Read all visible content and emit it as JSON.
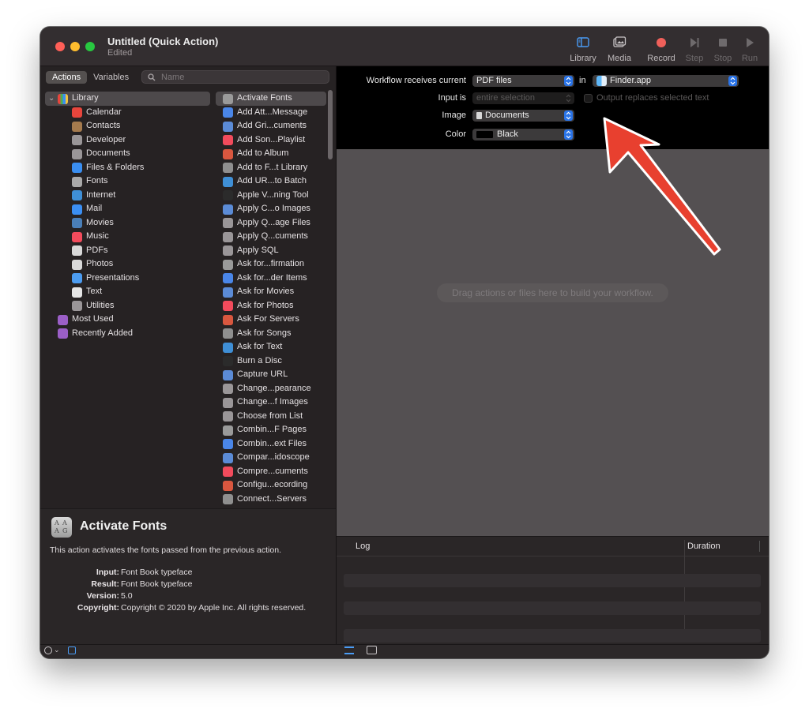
{
  "window": {
    "title": "Untitled (Quick Action)",
    "subtitle": "Edited"
  },
  "toolbar": [
    {
      "label": "Library",
      "icon": "library-icon",
      "enabled": true
    },
    {
      "label": "Media",
      "icon": "media-icon",
      "enabled": true
    },
    {
      "label": "Record",
      "icon": "record-icon",
      "enabled": true
    },
    {
      "label": "Step",
      "icon": "step-icon",
      "enabled": false
    },
    {
      "label": "Stop",
      "icon": "stop-icon",
      "enabled": false
    },
    {
      "label": "Run",
      "icon": "run-icon",
      "enabled": false
    }
  ],
  "tabs": {
    "actions": "Actions",
    "variables": "Variables"
  },
  "search": {
    "placeholder": "Name"
  },
  "library": {
    "root": "Library",
    "categories": [
      {
        "name": "Calendar",
        "color": "#e8453c"
      },
      {
        "name": "Contacts",
        "color": "#a57b4e"
      },
      {
        "name": "Developer",
        "color": "#9a9698"
      },
      {
        "name": "Documents",
        "color": "#9a9698"
      },
      {
        "name": "Files & Folders",
        "color": "#3a8ef0"
      },
      {
        "name": "Fonts",
        "color": "#a9a9a9"
      },
      {
        "name": "Internet",
        "color": "#3f8fd6"
      },
      {
        "name": "Mail",
        "color": "#3b8ff3"
      },
      {
        "name": "Movies",
        "color": "#4a7fb8"
      },
      {
        "name": "Music",
        "color": "#f24b5c"
      },
      {
        "name": "PDFs",
        "color": "#d9d9d9"
      },
      {
        "name": "Photos",
        "color": "#d9d9d9"
      },
      {
        "name": "Presentations",
        "color": "#4c9cf0"
      },
      {
        "name": "Text",
        "color": "#e5e5e5"
      },
      {
        "name": "Utilities",
        "color": "#9a9698"
      }
    ],
    "smart_groups": [
      "Most Used",
      "Recently Added"
    ]
  },
  "actions": [
    "Activate Fonts",
    "Add Att...Message",
    "Add Gri...cuments",
    "Add Son...Playlist",
    "Add to Album",
    "Add to F...t Library",
    "Add UR...to Batch",
    "Apple V...ning Tool",
    "Apply C...o Images",
    "Apply Q...age Files",
    "Apply Q...cuments",
    "Apply SQL",
    "Ask for...firmation",
    "Ask for...der Items",
    "Ask for Movies",
    "Ask for Photos",
    "Ask For Servers",
    "Ask for Songs",
    "Ask for Text",
    "Burn a Disc",
    "Capture URL",
    "Change...pearance",
    "Change...f Images",
    "Choose from List",
    "Combin...F Pages",
    "Combin...ext Files",
    "Compar...idoscope",
    "Compre...cuments",
    "Configu...ecording",
    "Connect...Servers"
  ],
  "description": {
    "title": "Activate Fonts",
    "text": "This action activates the fonts passed from the previous action.",
    "input_label": "Input:",
    "input": "Font Book typeface",
    "result_label": "Result:",
    "result": "Font Book typeface",
    "version_label": "Version:",
    "version": "5.0",
    "copyright_label": "Copyright:",
    "copyright": "Copyright © 2020 by Apple Inc. All rights reserved."
  },
  "workflow": {
    "receives_label": "Workflow receives current",
    "receives_value": "PDF files",
    "in_label": "in",
    "in_value": "Finder.app",
    "input_is_label": "Input is",
    "input_is_value": "entire selection",
    "output_replaces": "Output replaces selected text",
    "image_label": "Image",
    "image_value": "Documents",
    "color_label": "Color",
    "color_value": "Black",
    "drop_hint": "Drag actions or files here to build your workflow."
  },
  "log": {
    "col_log": "Log",
    "col_duration": "Duration"
  },
  "colors": {
    "accent": "#2a74e8",
    "arrow": "#e8402f"
  }
}
